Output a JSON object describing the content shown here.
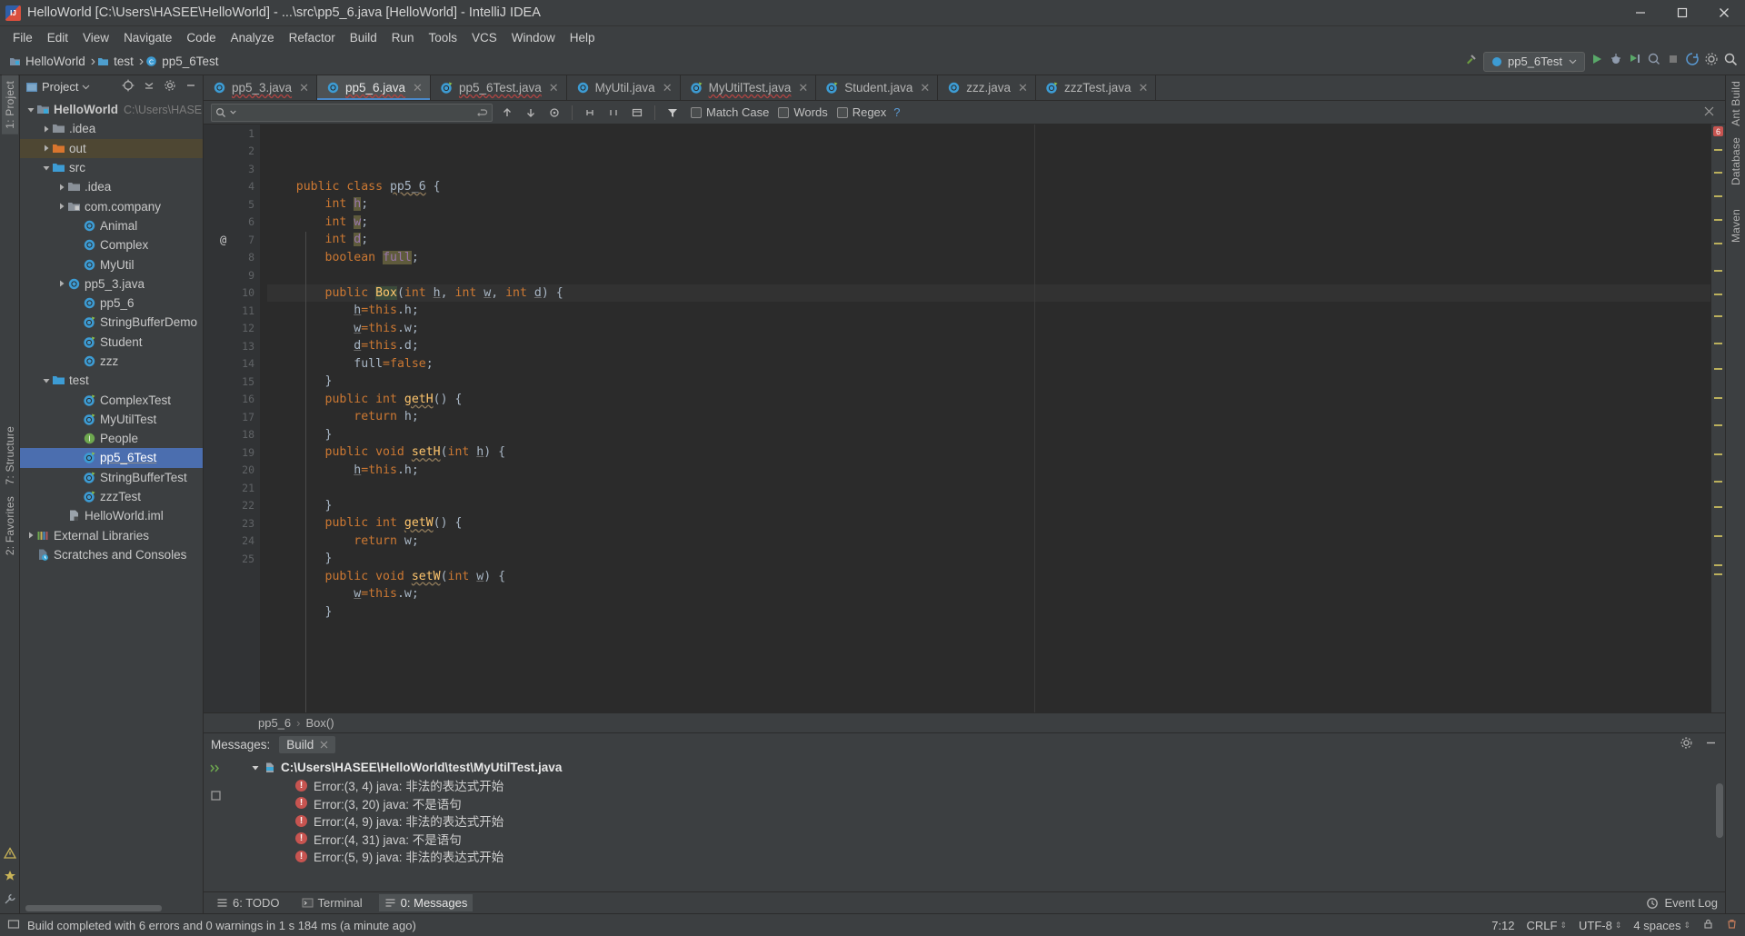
{
  "window": {
    "title": "HelloWorld [C:\\Users\\HASEE\\HelloWorld] - ...\\src\\pp5_6.java [HelloWorld] - IntelliJ IDEA",
    "minimize": "—",
    "maximize": "□",
    "close": "✕"
  },
  "menu": [
    "File",
    "Edit",
    "View",
    "Navigate",
    "Code",
    "Analyze",
    "Refactor",
    "Build",
    "Run",
    "Tools",
    "VCS",
    "Window",
    "Help"
  ],
  "navbar": {
    "crumbs": [
      "HelloWorld",
      "test",
      "pp5_6Test"
    ],
    "separator": "›",
    "run_config": "pp5_6Test"
  },
  "left_rail": {
    "top": "1: Project",
    "mid": "7: Structure",
    "bottom": "2: Favorites"
  },
  "right_rail": {
    "items": [
      "Ant Build",
      "Database",
      "Maven"
    ]
  },
  "project_panel": {
    "title": "Project",
    "tree": [
      {
        "depth": 0,
        "arrow": "down",
        "icon": "project-folder",
        "label": "HelloWorld",
        "sub": "C:\\Users\\HASE",
        "state": "normal"
      },
      {
        "depth": 1,
        "arrow": "right",
        "icon": "folder-grey",
        "label": ".idea",
        "sub": "",
        "state": "normal"
      },
      {
        "depth": 1,
        "arrow": "right",
        "icon": "folder-orange",
        "label": "out",
        "sub": "",
        "state": "highlight"
      },
      {
        "depth": 1,
        "arrow": "down",
        "icon": "folder-blue",
        "label": "src",
        "sub": "",
        "state": "normal"
      },
      {
        "depth": 2,
        "arrow": "right",
        "icon": "folder-grey",
        "label": ".idea",
        "sub": "",
        "state": "normal"
      },
      {
        "depth": 2,
        "arrow": "right",
        "icon": "package",
        "label": "com.company",
        "sub": "",
        "state": "normal"
      },
      {
        "depth": 3,
        "arrow": "none",
        "icon": "class",
        "label": "Animal",
        "sub": "",
        "state": "normal"
      },
      {
        "depth": 3,
        "arrow": "none",
        "icon": "class",
        "label": "Complex",
        "sub": "",
        "state": "normal"
      },
      {
        "depth": 3,
        "arrow": "none",
        "icon": "class",
        "label": "MyUtil",
        "sub": "",
        "state": "normal"
      },
      {
        "depth": 2,
        "arrow": "right",
        "icon": "class",
        "label": "pp5_3.java",
        "sub": "",
        "state": "normal"
      },
      {
        "depth": 3,
        "arrow": "none",
        "icon": "class",
        "label": "pp5_6",
        "sub": "",
        "state": "normal"
      },
      {
        "depth": 3,
        "arrow": "none",
        "icon": "class-run",
        "label": "StringBufferDemo",
        "sub": "",
        "state": "normal"
      },
      {
        "depth": 3,
        "arrow": "none",
        "icon": "class-run",
        "label": "Student",
        "sub": "",
        "state": "normal"
      },
      {
        "depth": 3,
        "arrow": "none",
        "icon": "class",
        "label": "zzz",
        "sub": "",
        "state": "normal"
      },
      {
        "depth": 1,
        "arrow": "down",
        "icon": "folder-blue",
        "label": "test",
        "sub": "",
        "state": "normal"
      },
      {
        "depth": 3,
        "arrow": "none",
        "icon": "class-run",
        "label": "ComplexTest",
        "sub": "",
        "state": "normal"
      },
      {
        "depth": 3,
        "arrow": "none",
        "icon": "class-run",
        "label": "MyUtilTest",
        "sub": "",
        "state": "normal"
      },
      {
        "depth": 3,
        "arrow": "none",
        "icon": "interface",
        "label": "People",
        "sub": "",
        "state": "normal"
      },
      {
        "depth": 3,
        "arrow": "none",
        "icon": "class-run",
        "label": "pp5_6Test",
        "sub": "",
        "state": "selected"
      },
      {
        "depth": 3,
        "arrow": "none",
        "icon": "class-run",
        "label": "StringBufferTest",
        "sub": "",
        "state": "normal"
      },
      {
        "depth": 3,
        "arrow": "none",
        "icon": "class-run",
        "label": "zzzTest",
        "sub": "",
        "state": "normal"
      },
      {
        "depth": 2,
        "arrow": "none",
        "icon": "iml",
        "label": "HelloWorld.iml",
        "sub": "",
        "state": "normal"
      },
      {
        "depth": 0,
        "arrow": "right",
        "icon": "libraries",
        "label": "External Libraries",
        "sub": "",
        "state": "normal"
      },
      {
        "depth": 0,
        "arrow": "none",
        "icon": "scratches",
        "label": "Scratches and Consoles",
        "sub": "",
        "state": "normal"
      }
    ]
  },
  "editor_tabs": [
    {
      "label": "pp5_3.java",
      "icon": "class",
      "active": false,
      "error": true
    },
    {
      "label": "pp5_6.java",
      "icon": "class",
      "active": true,
      "error": true
    },
    {
      "label": "pp5_6Test.java",
      "icon": "class-run",
      "active": false,
      "error": true
    },
    {
      "label": "MyUtil.java",
      "icon": "class",
      "active": false,
      "error": false
    },
    {
      "label": "MyUtilTest.java",
      "icon": "class-run",
      "active": false,
      "error": true
    },
    {
      "label": "Student.java",
      "icon": "class-run",
      "active": false,
      "error": false
    },
    {
      "label": "zzz.java",
      "icon": "class",
      "active": false,
      "error": false
    },
    {
      "label": "zzzTest.java",
      "icon": "class-run",
      "active": false,
      "error": false
    }
  ],
  "find_bar": {
    "placeholder": "",
    "value": "",
    "match_case": "Match Case",
    "words": "Words",
    "regex": "Regex",
    "help": "?"
  },
  "code": {
    "lines": [
      {
        "n": 1,
        "indent": 0,
        "tokens": [
          {
            "t": "public ",
            "c": "kw"
          },
          {
            "t": "class ",
            "c": "kw"
          },
          {
            "t": "pp5_6",
            "c": "cls wavyc"
          },
          {
            "t": " {",
            "c": "pl"
          }
        ]
      },
      {
        "n": 2,
        "indent": 1,
        "tokens": [
          {
            "t": "int ",
            "c": "kw"
          },
          {
            "t": "h",
            "c": "fld hl-olive"
          },
          {
            "t": ";",
            "c": "pl"
          }
        ]
      },
      {
        "n": 3,
        "indent": 1,
        "tokens": [
          {
            "t": "int ",
            "c": "kw"
          },
          {
            "t": "w",
            "c": "fld hl-olive"
          },
          {
            "t": ";",
            "c": "pl"
          }
        ]
      },
      {
        "n": 4,
        "indent": 1,
        "tokens": [
          {
            "t": "int ",
            "c": "kw"
          },
          {
            "t": "d",
            "c": "fld hl-olive"
          },
          {
            "t": ";",
            "c": "pl"
          }
        ]
      },
      {
        "n": 5,
        "indent": 1,
        "tokens": [
          {
            "t": "boolean ",
            "c": "kw"
          },
          {
            "t": "full",
            "c": "fld hl-olive"
          },
          {
            "t": ";",
            "c": "pl"
          }
        ]
      },
      {
        "n": 6,
        "indent": 1,
        "tokens": []
      },
      {
        "n": 7,
        "indent": 1,
        "tokens": [
          {
            "t": "public ",
            "c": "kw"
          },
          {
            "t": "Box",
            "c": "mth hl-green"
          },
          {
            "t": "(",
            "c": "pl"
          },
          {
            "t": "int ",
            "c": "kw"
          },
          {
            "t": "h",
            "c": "pl uline"
          },
          {
            "t": ", ",
            "c": "pl"
          },
          {
            "t": "int ",
            "c": "kw"
          },
          {
            "t": "w",
            "c": "pl uline"
          },
          {
            "t": ", ",
            "c": "pl"
          },
          {
            "t": "int ",
            "c": "kw"
          },
          {
            "t": "d",
            "c": "pl uline"
          },
          {
            "t": ") {",
            "c": "pl"
          }
        ],
        "mark": "@",
        "fold": "open",
        "caret": true
      },
      {
        "n": 8,
        "indent": 2,
        "tokens": [
          {
            "t": "h",
            "c": "pl uline"
          },
          {
            "t": "=",
            "c": "kw"
          },
          {
            "t": "this",
            "c": "kw"
          },
          {
            "t": ".h;",
            "c": "pl"
          }
        ]
      },
      {
        "n": 9,
        "indent": 2,
        "tokens": [
          {
            "t": "w",
            "c": "pl uline"
          },
          {
            "t": "=",
            "c": "kw"
          },
          {
            "t": "this",
            "c": "kw"
          },
          {
            "t": ".w;",
            "c": "pl"
          }
        ]
      },
      {
        "n": 10,
        "indent": 2,
        "tokens": [
          {
            "t": "d",
            "c": "pl uline"
          },
          {
            "t": "=",
            "c": "kw"
          },
          {
            "t": "this",
            "c": "kw"
          },
          {
            "t": ".d;",
            "c": "pl"
          }
        ]
      },
      {
        "n": 11,
        "indent": 2,
        "tokens": [
          {
            "t": "full",
            "c": "pl"
          },
          {
            "t": "=",
            "c": "kw"
          },
          {
            "t": "false",
            "c": "kw"
          },
          {
            "t": ";",
            "c": "pl"
          }
        ]
      },
      {
        "n": 12,
        "indent": 1,
        "tokens": [
          {
            "t": "}",
            "c": "pl"
          }
        ],
        "fold": "end"
      },
      {
        "n": 13,
        "indent": 1,
        "tokens": [
          {
            "t": "public ",
            "c": "kw"
          },
          {
            "t": "int ",
            "c": "kw"
          },
          {
            "t": "getH",
            "c": "mth wavyc"
          },
          {
            "t": "() {",
            "c": "pl"
          }
        ],
        "fold": "open"
      },
      {
        "n": 14,
        "indent": 2,
        "tokens": [
          {
            "t": "return ",
            "c": "kw"
          },
          {
            "t": "h",
            "c": "pl"
          },
          {
            "t": ";",
            "c": "pl"
          }
        ]
      },
      {
        "n": 15,
        "indent": 1,
        "tokens": [
          {
            "t": "}",
            "c": "pl"
          }
        ],
        "fold": "end"
      },
      {
        "n": 16,
        "indent": 1,
        "tokens": [
          {
            "t": "public ",
            "c": "kw"
          },
          {
            "t": "void ",
            "c": "kw"
          },
          {
            "t": "setH",
            "c": "mth wavyc"
          },
          {
            "t": "(",
            "c": "pl"
          },
          {
            "t": "int ",
            "c": "kw"
          },
          {
            "t": "h",
            "c": "pl uline"
          },
          {
            "t": ") {",
            "c": "pl"
          }
        ],
        "fold": "open"
      },
      {
        "n": 17,
        "indent": 2,
        "tokens": [
          {
            "t": "h",
            "c": "pl uline"
          },
          {
            "t": "=",
            "c": "kw"
          },
          {
            "t": "this",
            "c": "kw"
          },
          {
            "t": ".h;",
            "c": "pl"
          }
        ]
      },
      {
        "n": 18,
        "indent": 1,
        "tokens": []
      },
      {
        "n": 19,
        "indent": 1,
        "tokens": [
          {
            "t": "}",
            "c": "pl"
          }
        ],
        "fold": "end"
      },
      {
        "n": 20,
        "indent": 1,
        "tokens": [
          {
            "t": "public ",
            "c": "kw"
          },
          {
            "t": "int ",
            "c": "kw"
          },
          {
            "t": "getW",
            "c": "mth wavyc"
          },
          {
            "t": "() {",
            "c": "pl"
          }
        ],
        "fold": "open"
      },
      {
        "n": 21,
        "indent": 2,
        "tokens": [
          {
            "t": "return ",
            "c": "kw"
          },
          {
            "t": "w",
            "c": "pl"
          },
          {
            "t": ";",
            "c": "pl"
          }
        ]
      },
      {
        "n": 22,
        "indent": 1,
        "tokens": [
          {
            "t": "}",
            "c": "pl"
          }
        ],
        "fold": "end"
      },
      {
        "n": 23,
        "indent": 1,
        "tokens": [
          {
            "t": "public ",
            "c": "kw"
          },
          {
            "t": "void ",
            "c": "kw"
          },
          {
            "t": "setW",
            "c": "mth wavyc"
          },
          {
            "t": "(",
            "c": "pl"
          },
          {
            "t": "int ",
            "c": "kw"
          },
          {
            "t": "w",
            "c": "pl uline"
          },
          {
            "t": ") {",
            "c": "pl"
          }
        ],
        "fold": "open"
      },
      {
        "n": 24,
        "indent": 2,
        "tokens": [
          {
            "t": "w",
            "c": "pl uline"
          },
          {
            "t": "=",
            "c": "kw"
          },
          {
            "t": "this",
            "c": "kw"
          },
          {
            "t": ".w;",
            "c": "pl"
          }
        ]
      },
      {
        "n": 25,
        "indent": 1,
        "tokens": [
          {
            "t": "}",
            "c": "pl"
          }
        ],
        "fold": "end"
      }
    ],
    "breadcrumb": [
      "pp5_6",
      "Box()"
    ],
    "breadcrumb_sep": "›",
    "error_count_badge": "6"
  },
  "messages": {
    "label": "Messages:",
    "tab": "Build",
    "file": "C:\\Users\\HASEE\\HelloWorld\\test\\MyUtilTest.java",
    "errors": [
      "Error:(3, 4)  java: 非法的表达式开始",
      "Error:(3, 20)  java: 不是语句",
      "Error:(4, 9)  java: 非法的表达式开始",
      "Error:(4, 31)  java: 不是语句",
      "Error:(5, 9)  java: 非法的表达式开始"
    ]
  },
  "bottom_tabs": [
    {
      "label": "6: TODO",
      "active": false
    },
    {
      "label": "Terminal",
      "active": false
    },
    {
      "label": "0: Messages",
      "active": true
    }
  ],
  "event_log": "Event Log",
  "status": {
    "message": "Build completed with 6 errors and 0 warnings in 1 s 184 ms (a minute ago)",
    "position": "7:12",
    "line_sep": "CRLF",
    "encoding": "UTF-8",
    "indent": "4 spaces"
  },
  "colors": {
    "accent": "#4b6eaf",
    "error": "#c75450",
    "keyword": "#cc7832",
    "method": "#ffc66d",
    "field": "#9876aa",
    "bg_panel": "#3c3f41",
    "bg_editor": "#2b2b2b"
  }
}
